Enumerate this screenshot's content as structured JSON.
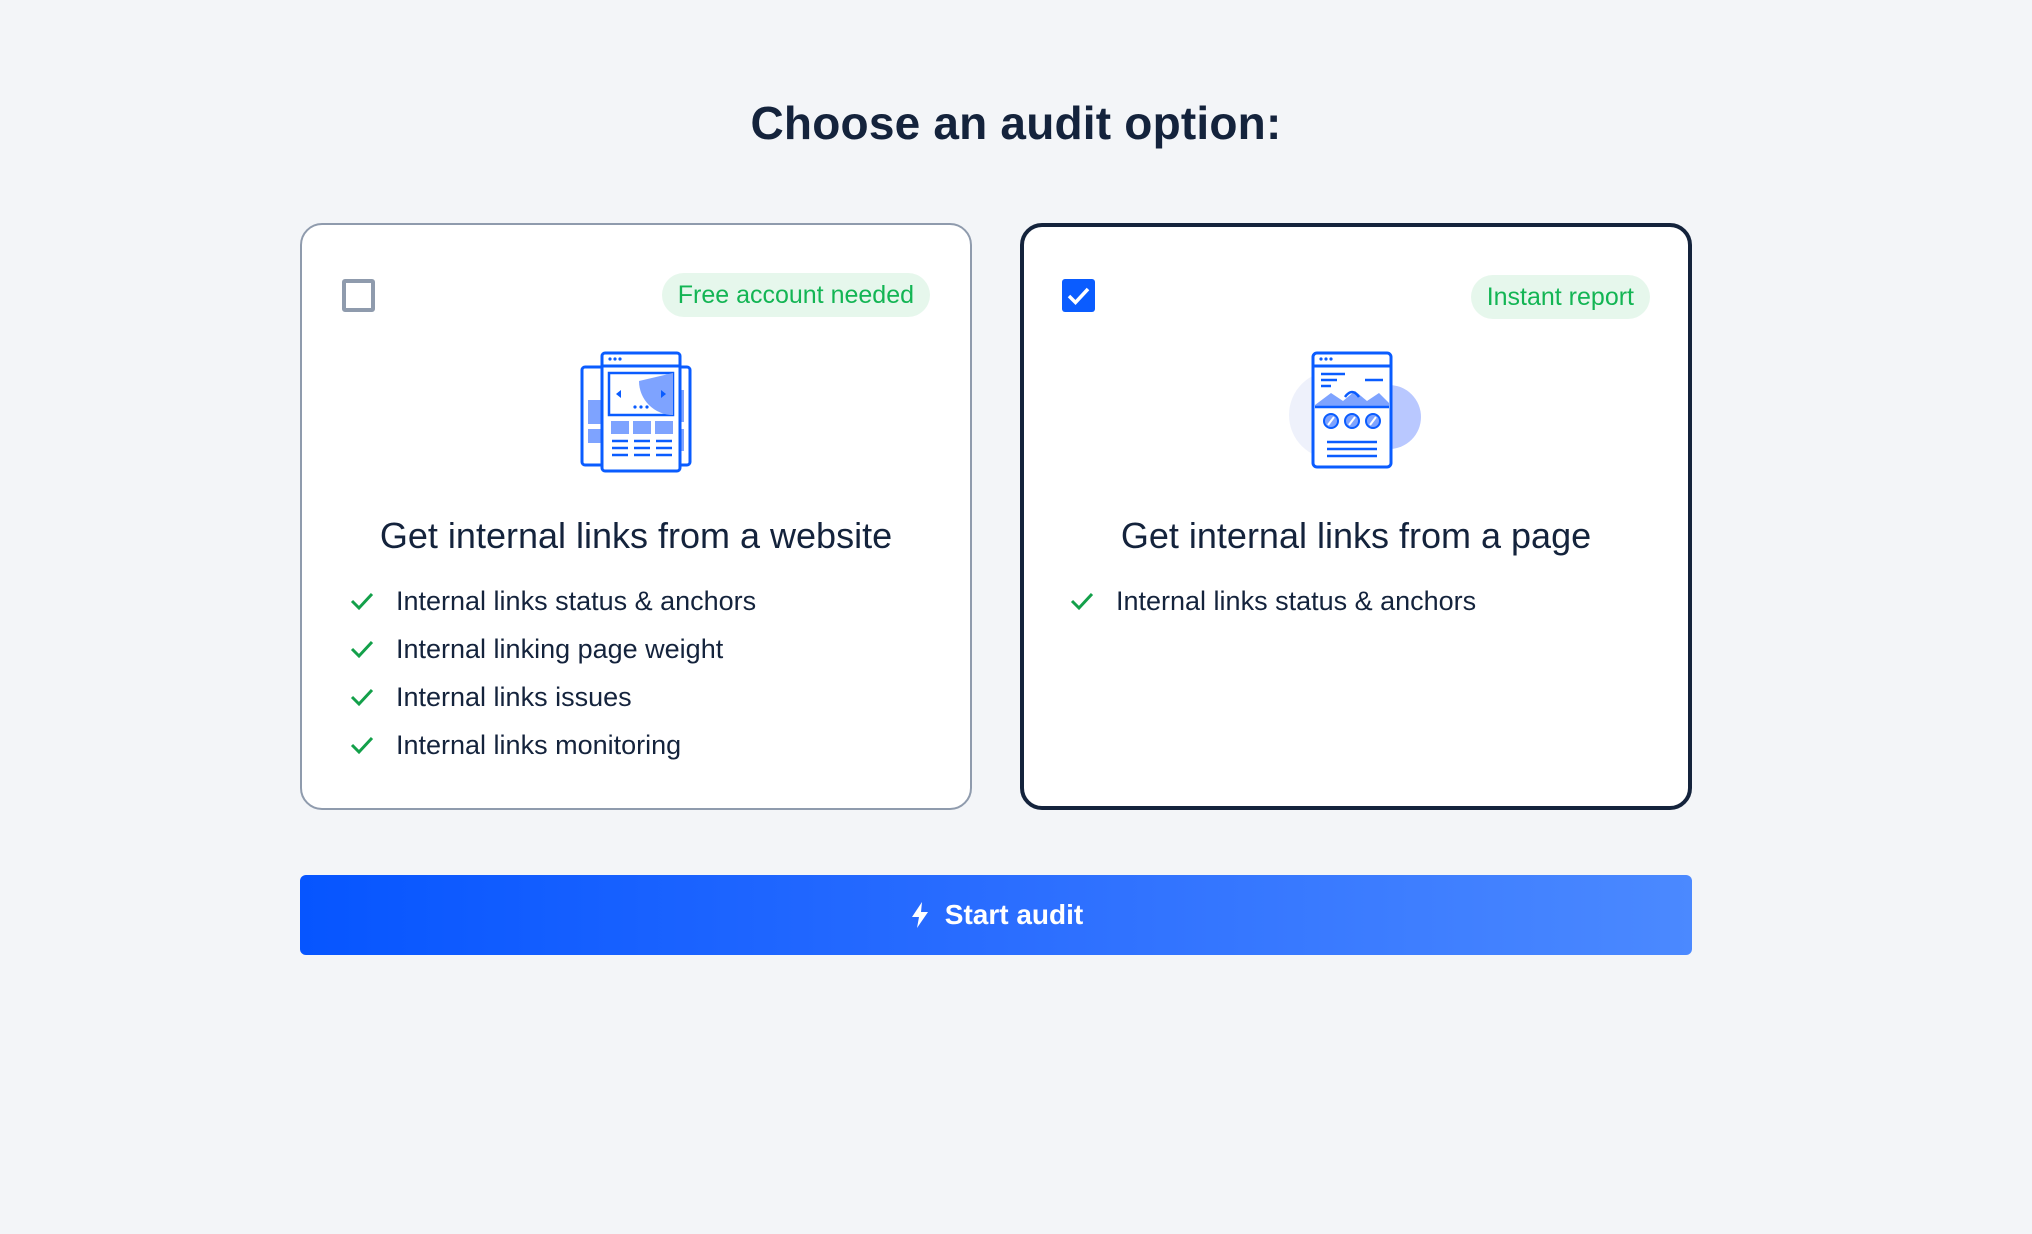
{
  "page": {
    "title": "Choose an audit option:"
  },
  "options": [
    {
      "selected": false,
      "badge": "Free account needed",
      "title": "Get internal links from a website",
      "illustration": "website-pages-illustration",
      "features": [
        "Internal links status & anchors",
        "Internal linking page weight",
        "Internal links issues",
        "Internal links monitoring"
      ]
    },
    {
      "selected": true,
      "badge": "Instant report",
      "title": "Get internal links from a page",
      "illustration": "single-page-illustration",
      "features": [
        "Internal links status & anchors"
      ]
    }
  ],
  "action": {
    "start_label": "Start audit",
    "icon": "lightning-bolt-icon"
  },
  "colors": {
    "background": "#f3f5f8",
    "accent": "#0a5cff",
    "badge_text": "#13b554",
    "badge_bg": "#e6f7ec",
    "check": "#13a04a",
    "text": "#14233c",
    "selected_border": "#14233c",
    "unselected_border": "#8f9bad"
  }
}
